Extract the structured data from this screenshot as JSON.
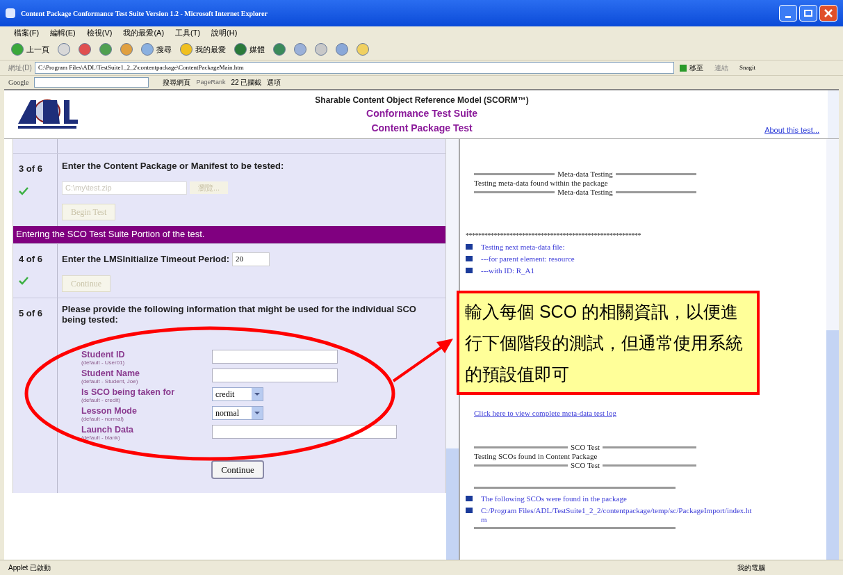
{
  "window": {
    "title": "Content Package Conformance Test Suite Version 1.2 - Microsoft Internet Explorer"
  },
  "menu": [
    "檔案(F)",
    "編輯(E)",
    "檢視(V)",
    "我的最愛(A)",
    "工具(T)",
    "說明(H)"
  ],
  "toolbar": {
    "back": "上一頁",
    "search": "搜尋",
    "favorites": "我的最愛",
    "media": "媒體"
  },
  "address_bar": {
    "label": "網址(D)",
    "value": "C:\\Program Files\\ADL\\TestSuite1_2_2\\contentpackage\\ContentPackageMain.htm",
    "go": "移至",
    "links": "連結",
    "snagit": "Snagit"
  },
  "google_bar": {
    "logo": "Google",
    "search": "搜尋網頁",
    "pagerank": "PageRank",
    "blocked": "22 已攔截",
    "options": "選項"
  },
  "header": {
    "line1": "Sharable Content Object Reference Model (SCORM™)",
    "line2": "Conformance Test Suite",
    "line3": "Content Package Test",
    "about": "About this test..."
  },
  "steps": [
    {
      "number": "3 of 6",
      "done": true,
      "prompt": "Enter the Content Package or Manifest to be tested:",
      "file_value": "C:\\my\\test.zip",
      "browse": "瀏覽...",
      "button": "Begin Test",
      "button_disabled": true
    },
    {
      "number": "4 of 6",
      "done": true,
      "banner": "Entering the SCO Test Suite Portion of the test.",
      "prompt": "Enter the LMSInitialize Timeout Period:",
      "timeout_value": "20",
      "button": "Continue",
      "button_disabled": true
    },
    {
      "number": "5 of 6",
      "done": false,
      "prompt": "Please provide the following information that might be used for the individual SCO being tested:",
      "button": "Continue",
      "button_disabled": false,
      "fields": [
        {
          "kind": "text",
          "label": "Student ID",
          "hint": "(default - User01)",
          "wide": false
        },
        {
          "kind": "text",
          "label": "Student Name",
          "hint": "(default - Student, Joe)",
          "wide": false
        },
        {
          "kind": "select",
          "label": "Is SCO being taken for",
          "hint": "(default - credit)",
          "value": "credit"
        },
        {
          "kind": "select",
          "label": "Lesson Mode",
          "hint": "(default - normal)",
          "value": "normal"
        },
        {
          "kind": "text",
          "label": "Launch Data",
          "hint": "(default - blank)",
          "wide": true
        }
      ]
    }
  ],
  "log_groups": [
    [
      {
        "kind": "banner",
        "text": "Meta-data Testing"
      },
      {
        "kind": "text",
        "text": "Testing meta-data found within the package"
      },
      {
        "kind": "banner",
        "text": "Meta-data Testing"
      }
    ],
    [
      {
        "kind": "stars",
        "text": "********************************************************"
      },
      {
        "kind": "bullet",
        "text": "Testing next meta-data file:"
      },
      {
        "kind": "bullet",
        "text": "---for parent element: resource"
      },
      {
        "kind": "bullet",
        "text": "---with ID: R_A1"
      }
    ],
    [
      {
        "kind": "link",
        "text": "Click here to view complete meta-data test log"
      }
    ],
    [
      {
        "kind": "banner",
        "text": "SCO Test"
      },
      {
        "kind": "text",
        "text": "Testing SCOs found in Content Package"
      },
      {
        "kind": "banner",
        "text": "SCO Test"
      }
    ],
    [
      {
        "kind": "rule"
      },
      {
        "kind": "bullet",
        "text": "The following SCOs were found in the package"
      },
      {
        "kind": "bullet",
        "text": "C:/Program Files/ADL/TestSuite1_2_2/contentpackage/temp/sc/PackageImport/index.htm"
      },
      {
        "kind": "rule"
      }
    ]
  ],
  "callout": {
    "text": "輸入每個 SCO 的相關資訊，以便進行下個階段的測試，但通常使用系統的預設值即可"
  },
  "status_bar": {
    "left": "Applet 已啟動",
    "right": "我的電腦"
  }
}
